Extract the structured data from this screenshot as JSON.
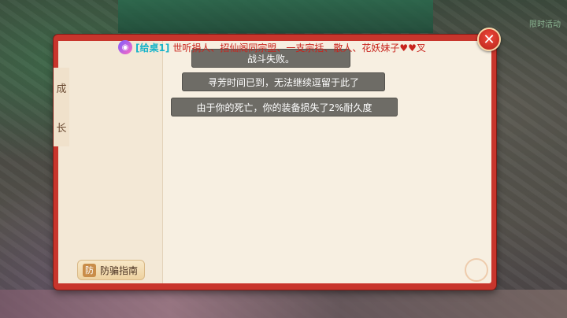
{
  "game": {
    "corner_text": "限时活动"
  },
  "broadcast": {
    "icon": "speaker-icon",
    "tag": "[给桌1]",
    "text": "世听捐人、招仙阁同宗盟、一支宗括、散人、花妖妹子♥♥叉"
  },
  "panel": {
    "side_tab": {
      "char1": "成",
      "char2": "长"
    },
    "antifraud_label": "防骗指南",
    "antifraud_icon": "shield-icon"
  },
  "messages": [
    "战斗失败。",
    "寻芳时间已到，无法继续逗留于此了",
    "由于你的死亡，你的装备损失了2%耐久度"
  ],
  "close": {
    "icon": "close-icon",
    "glyph": "✕"
  },
  "colors": {
    "frame_red": "#c8352c",
    "parchment": "#f7efe1",
    "message_bg": "#6e6c66",
    "broadcast_tag": "#18b3c9",
    "broadcast_text": "#c8241d"
  }
}
